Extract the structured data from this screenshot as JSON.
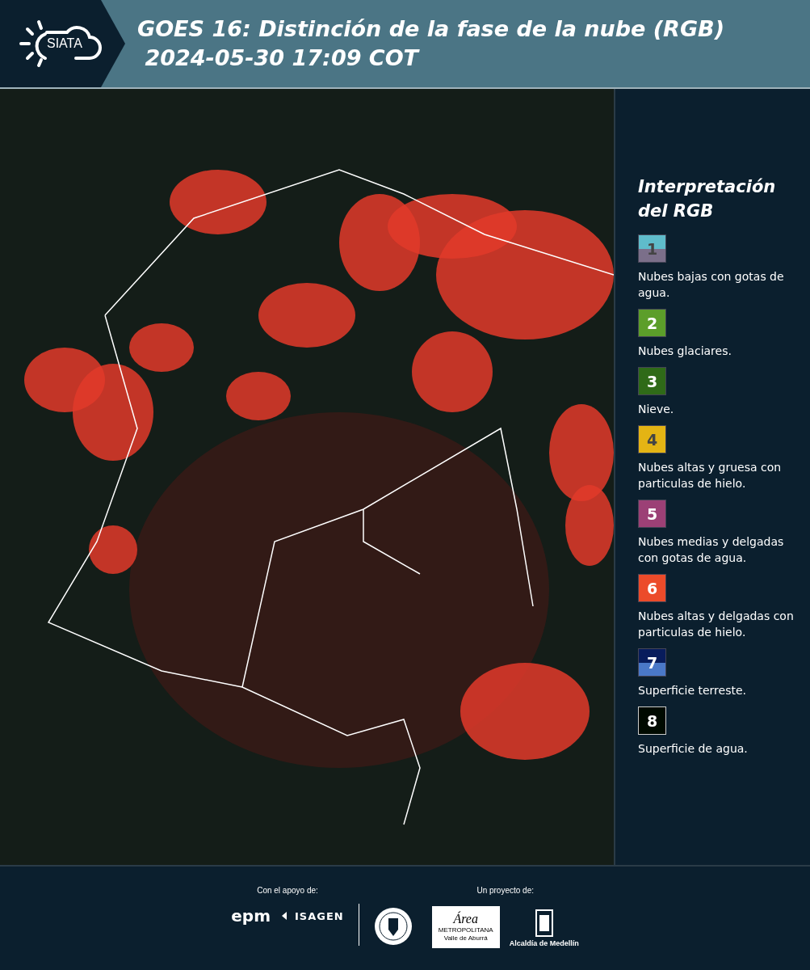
{
  "header": {
    "logo": "SIATA",
    "title": "GOES 16: Distinción de la fase de la nube (RGB)",
    "subtitle": "2024-05-30 17:09 COT"
  },
  "legend": {
    "title": "Interpretación del RGB",
    "items": [
      {
        "number": "1",
        "bands": [
          {
            "color": "#5fbccb"
          },
          {
            "color": "#7b6f8a"
          }
        ],
        "label": "Nubes bajas con gotas de agua."
      },
      {
        "number": "2",
        "color": "#5c9e2a",
        "label": "Nubes glaciares."
      },
      {
        "number": "3",
        "color": "#2f6a18",
        "label": "Nieve."
      },
      {
        "number": "4",
        "color": "#e4b414",
        "label": "Nubes altas y gruesa con particulas de hielo."
      },
      {
        "number": "5",
        "color": "#9c4076",
        "label": "Nubes medias y delgadas con gotas de agua."
      },
      {
        "number": "6",
        "color": "#ec4b2a",
        "label": "Nubes altas y delgadas con particulas de hielo."
      },
      {
        "number": "7",
        "bands": [
          {
            "color": "#081c5c"
          },
          {
            "color": "#4a78c8"
          }
        ],
        "label": "Superficie terreste."
      },
      {
        "number": "8",
        "color": "#000a00",
        "label": "Superficie de agua."
      }
    ]
  },
  "footer": {
    "support_label": "Con el apoyo de:",
    "support_logos": [
      "epm",
      "ISAGEN"
    ],
    "project_label": "Un proyecto de:",
    "area_logo": {
      "title": "Área",
      "line_1": "METROPOLITANA",
      "line_2": "Valle de Aburrá"
    },
    "alcaldia": "Alcaldía de Medellín"
  }
}
